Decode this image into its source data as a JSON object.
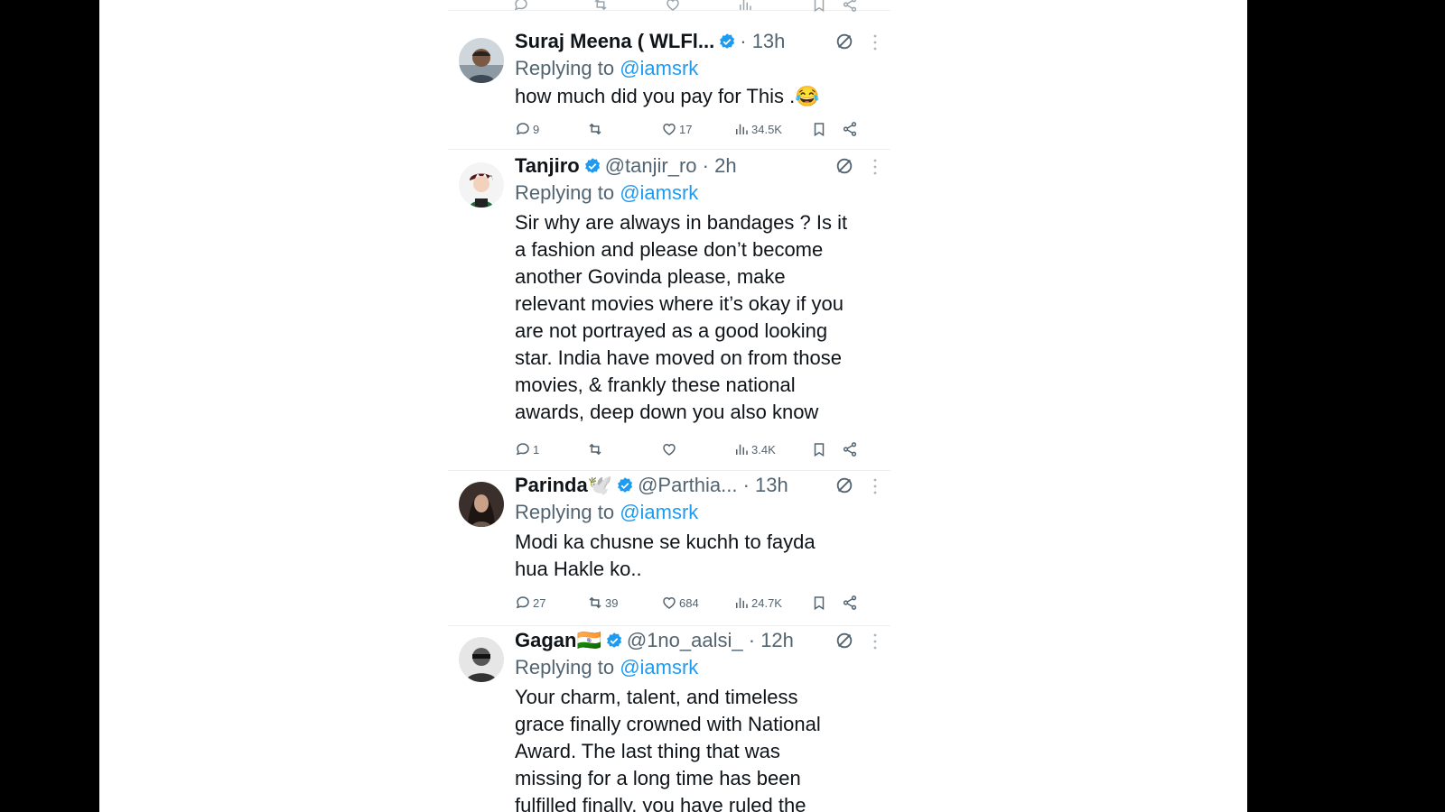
{
  "tweets": [
    {
      "name": "Suraj Meena ( WLFl...",
      "handle": "",
      "time": "· 13h",
      "reply_prefix": "Replying to",
      "reply_mention": "@iamsrk",
      "lines": [
        "how much did you pay for This .😂"
      ],
      "stats": {
        "replies": "9",
        "retweets": "",
        "likes": "17",
        "views": "34.5K"
      }
    },
    {
      "name": "Tanjiro",
      "handle": "@tanjir_ro",
      "time": "· 2h",
      "reply_prefix": "Replying to",
      "reply_mention": "@iamsrk",
      "lines": [
        "Sir why are always in bandages ? Is it",
        "a fashion and please don’t become",
        "another Govinda please, make",
        "relevant movies where it’s okay if you",
        "are not portrayed as a good looking",
        "star. India have moved on from those",
        "movies, & frankly these national",
        "awards, deep down you also know"
      ],
      "stats": {
        "replies": "1",
        "retweets": "",
        "likes": "",
        "views": "3.4K"
      }
    },
    {
      "name": "Parinda🕊️",
      "handle": "@Parthia...",
      "time": "· 13h",
      "reply_prefix": "Replying to",
      "reply_mention": "@iamsrk",
      "lines": [
        "Modi ka chusne se kuchh to fayda",
        "hua Hakle ko.."
      ],
      "stats": {
        "replies": "27",
        "retweets": "39",
        "likes": "684",
        "views": "24.7K"
      }
    },
    {
      "name": "Gagan🇮🇳",
      "handle": "@1no_aalsi_",
      "time": "· 12h",
      "reply_prefix": "Replying to",
      "reply_mention": "@iamsrk",
      "lines": [
        "Your charm, talent, and timeless",
        "grace finally crowned with National",
        "Award. The last thing that was",
        "missing for a long time has been",
        "fulfilled finally, you have ruled the"
      ],
      "stats": {
        "replies": "",
        "retweets": "",
        "likes": "",
        "views": ""
      }
    }
  ],
  "colors": {
    "text": "#0f1419",
    "muted": "#536471",
    "link": "#1d9bf0",
    "divider": "#eceff1"
  },
  "icons": [
    "verified-badge-icon",
    "grok-icon",
    "more-icon",
    "reply-icon",
    "retweet-icon",
    "like-icon",
    "views-icon",
    "bookmark-icon",
    "share-icon"
  ]
}
